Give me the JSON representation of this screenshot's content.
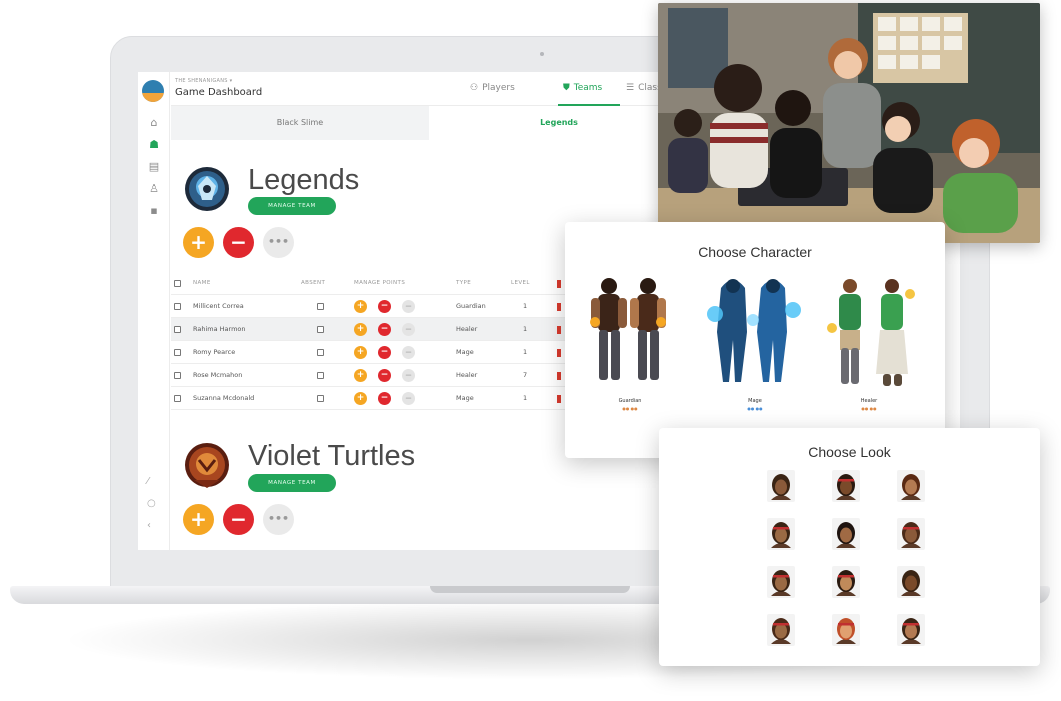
{
  "header": {
    "breadcrumb": "THE SHENANIGANS ▾",
    "title": "Game Dashboard",
    "tabs": [
      {
        "icon": "players-icon",
        "label": "Players"
      },
      {
        "icon": "teams-icon",
        "label": "Teams"
      },
      {
        "icon": "class-icon",
        "label": "Class"
      }
    ],
    "active_tab": "Teams"
  },
  "team_tabs": [
    "Black Slime",
    "Legends"
  ],
  "teams": [
    {
      "name": "Legends",
      "manage_label": "MANAGE TEAM",
      "more_label": "•••"
    },
    {
      "name": "Violet Turtles",
      "manage_label": "MANAGE TEAM",
      "more_label": "•••"
    }
  ],
  "table": {
    "columns": [
      "NAME",
      "ABSENT",
      "MANAGE POINTS",
      "TYPE",
      "LEVEL"
    ],
    "rows": [
      {
        "name": "Millicent Correa",
        "type": "Guardian",
        "level": "1"
      },
      {
        "name": "Rahima Harmon",
        "type": "Healer",
        "level": "1"
      },
      {
        "name": "Romy Pearce",
        "type": "Mage",
        "level": "1"
      },
      {
        "name": "Rose Mcmahon",
        "type": "Healer",
        "level": "7"
      },
      {
        "name": "Suzanna Mcdonald",
        "type": "Mage",
        "level": "1"
      }
    ]
  },
  "choose_character": {
    "title": "Choose Character",
    "characters": [
      "Guardian",
      "Mage",
      "Healer"
    ]
  },
  "choose_look": {
    "title": "Choose Look"
  },
  "colors": {
    "accent_green": "#22a55a",
    "plus_orange": "#f5a623",
    "minus_red": "#e0282e"
  }
}
